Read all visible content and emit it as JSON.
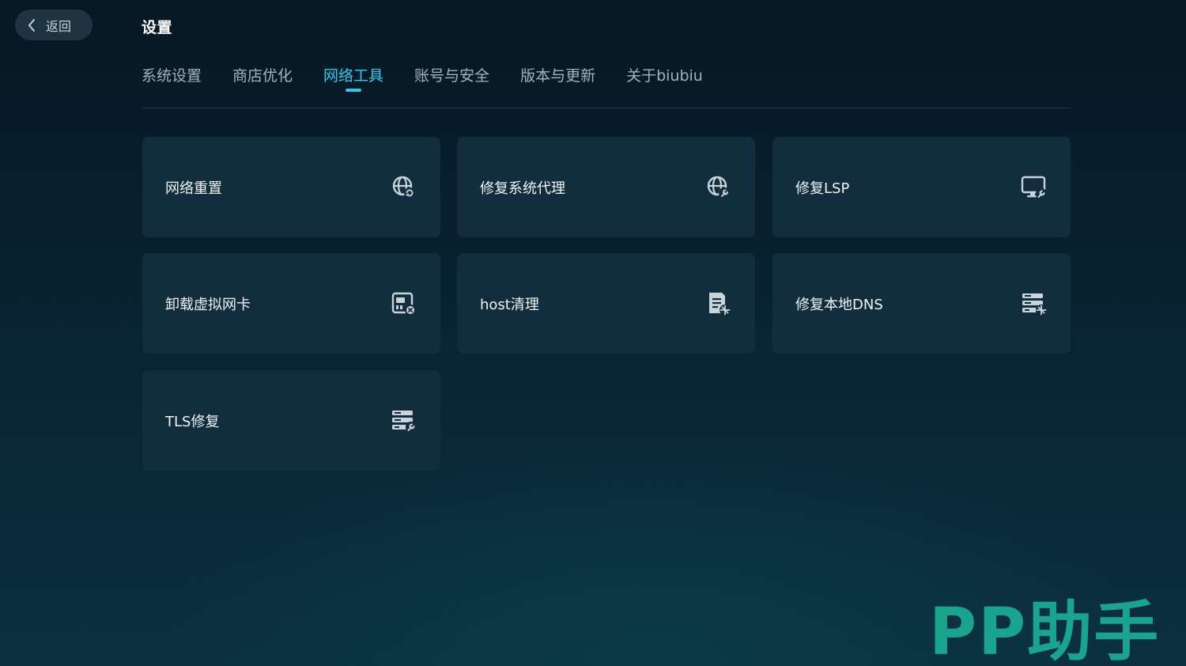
{
  "header": {
    "back_label": "返回",
    "title": "设置"
  },
  "tabs": [
    {
      "label": "系统设置"
    },
    {
      "label": "商店优化"
    },
    {
      "label": "网络工具",
      "active": true
    },
    {
      "label": "账号与安全"
    },
    {
      "label": "版本与更新"
    },
    {
      "label": "关于biubiu"
    }
  ],
  "cards": [
    {
      "label": "网络重置",
      "icon": "globe-refresh-icon"
    },
    {
      "label": "修复系统代理",
      "icon": "globe-wrench-icon"
    },
    {
      "label": "修复LSP",
      "icon": "monitor-wrench-icon"
    },
    {
      "label": "卸载虚拟网卡",
      "icon": "network-card-remove-icon"
    },
    {
      "label": "host清理",
      "icon": "document-clean-icon"
    },
    {
      "label": "修复本地DNS",
      "icon": "server-repair-icon"
    },
    {
      "label": "TLS修复",
      "icon": "server-wrench-icon"
    }
  ],
  "watermark": "PP助手",
  "colors": {
    "accent": "#35c6f0",
    "card_bg": "#122d3d",
    "watermark": "#1aa38e"
  }
}
